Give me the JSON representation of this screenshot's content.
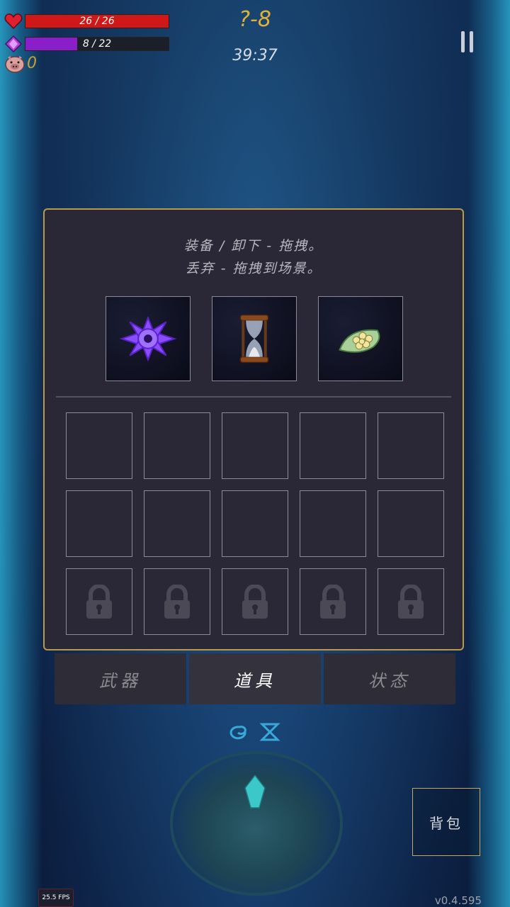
{
  "hud": {
    "health": {
      "text": "26 / 26",
      "current": 26,
      "max": 26,
      "color": "#d01818"
    },
    "mana": {
      "text": "8 / 22",
      "current": 8,
      "max": 22,
      "color": "#8a1ec8"
    },
    "coins": "0",
    "stage": "?-8",
    "timer": "39:37"
  },
  "inventory": {
    "hint_line1": "装备 / 卸下 - 拖拽。",
    "hint_line2": "丢弃 - 拖拽到场景。",
    "equipped": [
      {
        "icon": "purple-shuriken-icon"
      },
      {
        "icon": "hourglass-icon"
      },
      {
        "icon": "flower-leaf-icon"
      }
    ],
    "rows": [
      {
        "locked": false
      },
      {
        "locked": false
      },
      {
        "locked": true
      }
    ]
  },
  "tabs": [
    {
      "label": "武器",
      "active": false
    },
    {
      "label": "道具",
      "active": true
    },
    {
      "label": "状态",
      "active": false
    }
  ],
  "bag_label": "背包",
  "fps": "25.5 FPS",
  "version": "v0.4.595",
  "colors": {
    "panel_border": "#b89a48",
    "accent_gold": "#e0b13a"
  }
}
